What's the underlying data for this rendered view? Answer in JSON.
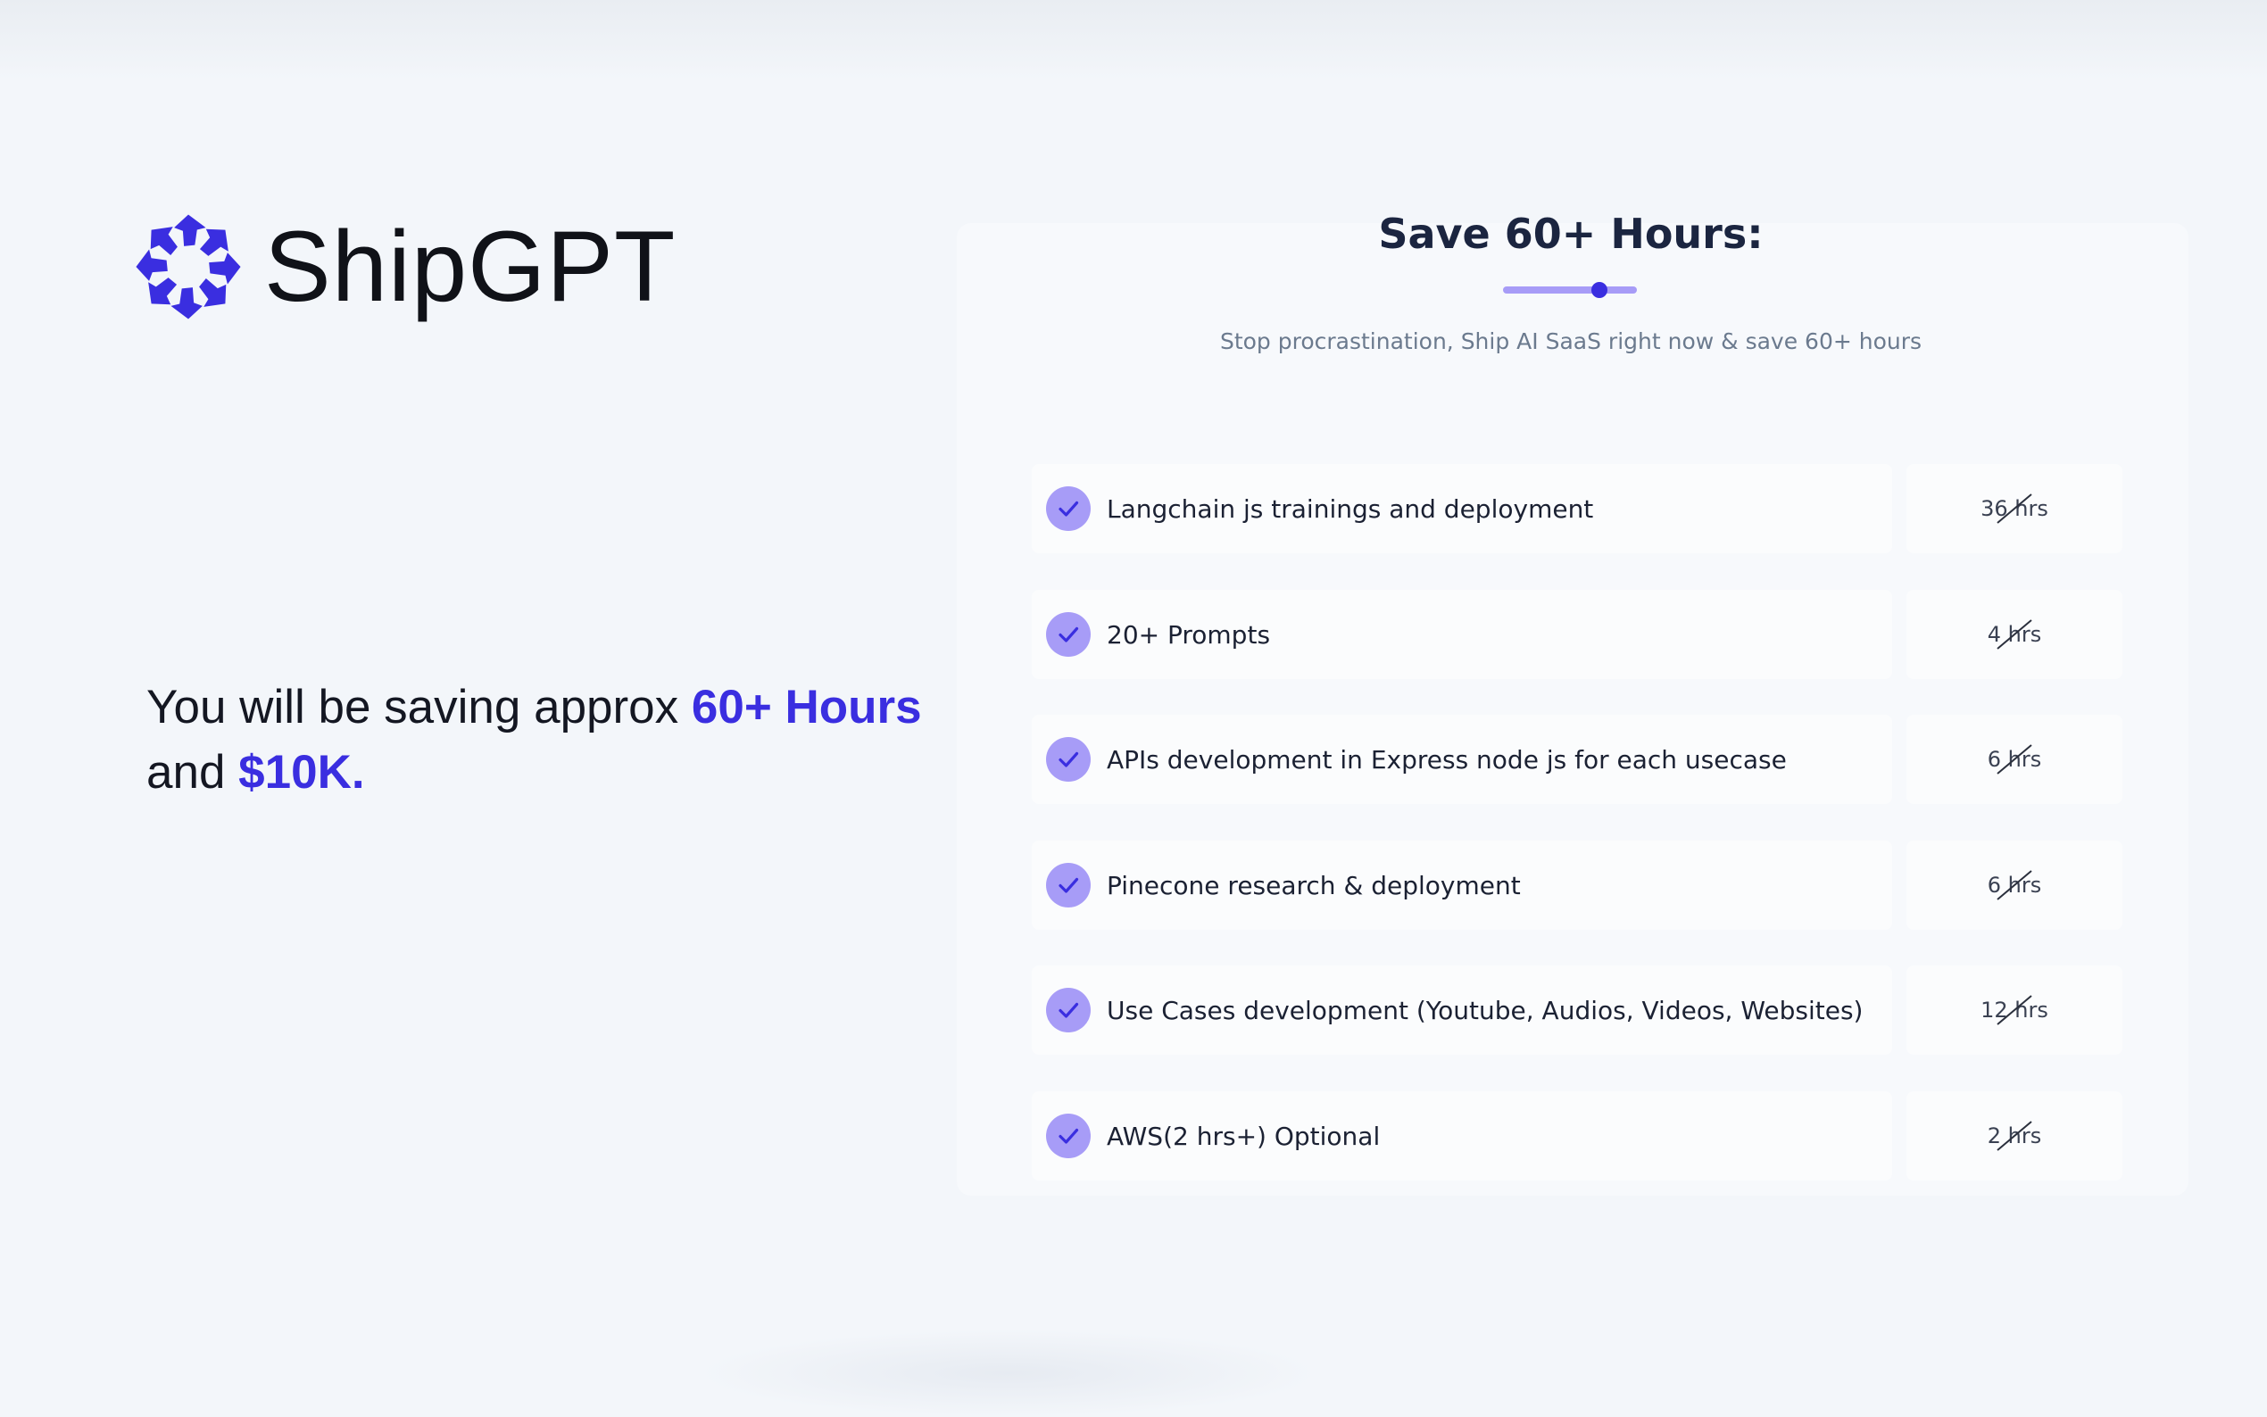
{
  "brand": {
    "name": "ShipGPT",
    "logo_icon": "spiral-arrows-icon",
    "accent_color": "#3a2ee0",
    "light_accent_color": "#a79cf7"
  },
  "savings_message": {
    "prefix": "You will be saving approx ",
    "hours": "60+ Hours",
    "connector": "and ",
    "money": "$10K."
  },
  "panel": {
    "title": "Save 60+ Hours:",
    "subtitle": "Stop procrastination, Ship AI SaaS right now & save 60+ hours",
    "slider_level": 0.72,
    "items": [
      {
        "label": "Langchain js trainings and deployment",
        "hours": "36 hrs"
      },
      {
        "label": "20+ Prompts",
        "hours": "4 hrs"
      },
      {
        "label": "APIs development in Express node js for each usecase",
        "hours": "6 hrs"
      },
      {
        "label": "Pinecone research & deployment",
        "hours": "6 hrs"
      },
      {
        "label": "Use Cases development (Youtube, Audios, Videos, Websites)",
        "hours": "12 hrs"
      },
      {
        "label": "AWS(2 hrs+) Optional",
        "hours": "2 hrs"
      }
    ]
  }
}
